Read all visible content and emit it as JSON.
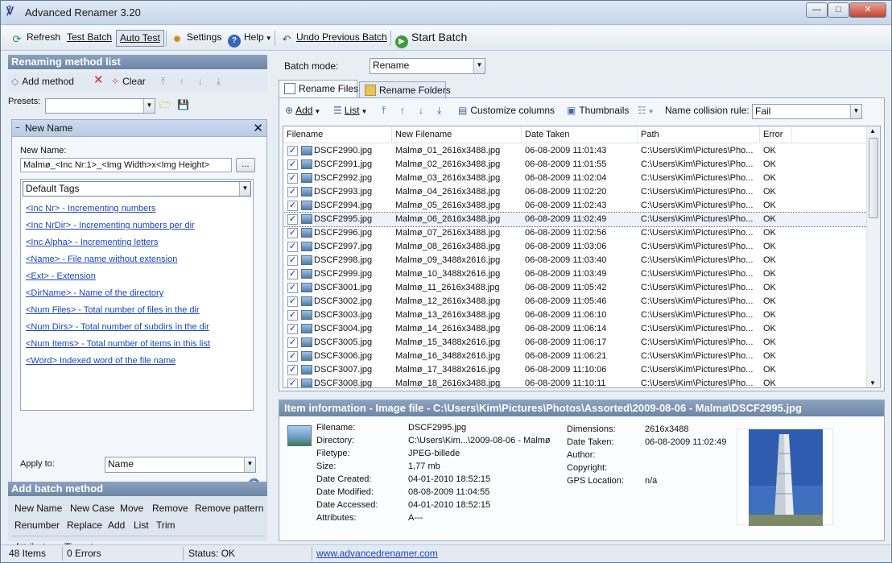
{
  "window": {
    "title": "Advanced Renamer 3.20",
    "controls": {
      "minimize": "—",
      "maximize": "□",
      "close": "✕"
    }
  },
  "toolbar": {
    "refresh": "Refresh",
    "test_batch": "Test Batch",
    "auto_test": "Auto Test",
    "settings": "Settings",
    "help": "Help",
    "undo": "Undo Previous Batch",
    "start": "Start Batch"
  },
  "left": {
    "title": "Renaming method list",
    "add_method": "Add method",
    "clear": "Clear",
    "presets_label": "Presets:",
    "presets_value": "",
    "method": {
      "name": "New Name",
      "new_name_label": "New Name:",
      "new_name_value": "Malmø_<Inc Nr:1>_<Img Width>x<Img Height>",
      "browse": "...",
      "tag_group": "Default Tags",
      "tags": [
        "<Inc Nr> - Incrementing numbers",
        "<Inc NrDir> - Incrementing numbers per dir",
        "<Inc Alpha> - Incrementing letters",
        "<Name> - File name without extension",
        "<Ext> - Extension",
        "<DirName> - Name of the directory",
        "<Num Files> - Total number of files in the dir",
        "<Num Dirs> - Total number of subdirs in the dir",
        "<Num Items> - Total number of items in this list",
        "<Word> Indexed word of the file name"
      ],
      "apply_to_label": "Apply to:",
      "apply_to_value": "Name",
      "help": "?"
    },
    "batch": {
      "title": "Add batch method",
      "methods": [
        "New Name",
        "New Case",
        "Move",
        "Remove",
        "Remove pattern",
        "Renumber",
        "Replace",
        "Add",
        "List",
        "Trim",
        "Attributes",
        "Timestamp"
      ]
    }
  },
  "right": {
    "batch_mode_label": "Batch mode:",
    "batch_mode_value": "Rename",
    "tabs": [
      "Rename Files",
      "Rename Folders"
    ],
    "list_toolbar": {
      "add": "Add",
      "list": "List",
      "customize": "Customize columns",
      "thumbnails": "Thumbnails",
      "collision_label": "Name collision rule:",
      "collision_value": "Fail"
    },
    "columns": [
      "Filename",
      "New Filename",
      "Date Taken",
      "Path",
      "Error"
    ],
    "rows": [
      [
        "DSCF2990.jpg",
        "Malmø_01_2616x3488.jpg",
        "06-08-2009 11:01:43",
        "C:\\Users\\Kim\\Pictures\\Pho...",
        "OK"
      ],
      [
        "DSCF2991.jpg",
        "Malmø_02_2616x3488.jpg",
        "06-08-2009 11:01:55",
        "C:\\Users\\Kim\\Pictures\\Pho...",
        "OK"
      ],
      [
        "DSCF2992.jpg",
        "Malmø_03_2616x3488.jpg",
        "06-08-2009 11:02:04",
        "C:\\Users\\Kim\\Pictures\\Pho...",
        "OK"
      ],
      [
        "DSCF2993.jpg",
        "Malmø_04_2616x3488.jpg",
        "06-08-2009 11:02:20",
        "C:\\Users\\Kim\\Pictures\\Pho...",
        "OK"
      ],
      [
        "DSCF2994.jpg",
        "Malmø_05_2616x3488.jpg",
        "06-08-2009 11:02:43",
        "C:\\Users\\Kim\\Pictures\\Pho...",
        "OK"
      ],
      [
        "DSCF2995.jpg",
        "Malmø_06_2616x3488.jpg",
        "06-08-2009 11:02:49",
        "C:\\Users\\Kim\\Pictures\\Pho...",
        "OK"
      ],
      [
        "DSCF2996.jpg",
        "Malmø_07_2616x3488.jpg",
        "06-08-2009 11:02:56",
        "C:\\Users\\Kim\\Pictures\\Pho...",
        "OK"
      ],
      [
        "DSCF2997.jpg",
        "Malmø_08_2616x3488.jpg",
        "06-08-2009 11:03:06",
        "C:\\Users\\Kim\\Pictures\\Pho...",
        "OK"
      ],
      [
        "DSCF2998.jpg",
        "Malmø_09_3488x2616.jpg",
        "06-08-2009 11:03:40",
        "C:\\Users\\Kim\\Pictures\\Pho...",
        "OK"
      ],
      [
        "DSCF2999.jpg",
        "Malmø_10_3488x2616.jpg",
        "06-08-2009 11:03:49",
        "C:\\Users\\Kim\\Pictures\\Pho...",
        "OK"
      ],
      [
        "DSCF3001.jpg",
        "Malmø_11_2616x3488.jpg",
        "06-08-2009 11:05:42",
        "C:\\Users\\Kim\\Pictures\\Pho...",
        "OK"
      ],
      [
        "DSCF3002.jpg",
        "Malmø_12_2616x3488.jpg",
        "06-08-2009 11:05:46",
        "C:\\Users\\Kim\\Pictures\\Pho...",
        "OK"
      ],
      [
        "DSCF3003.jpg",
        "Malmø_13_2616x3488.jpg",
        "06-08-2009 11:06:10",
        "C:\\Users\\Kim\\Pictures\\Pho...",
        "OK"
      ],
      [
        "DSCF3004.jpg",
        "Malmø_14_2616x3488.jpg",
        "06-08-2009 11:06:14",
        "C:\\Users\\Kim\\Pictures\\Pho...",
        "OK"
      ],
      [
        "DSCF3005.jpg",
        "Malmø_15_3488x2616.jpg",
        "06-08-2009 11:06:17",
        "C:\\Users\\Kim\\Pictures\\Pho...",
        "OK"
      ],
      [
        "DSCF3006.jpg",
        "Malmø_16_3488x2616.jpg",
        "06-08-2009 11:06:21",
        "C:\\Users\\Kim\\Pictures\\Pho...",
        "OK"
      ],
      [
        "DSCF3007.jpg",
        "Malmø_17_3488x2616.jpg",
        "06-08-2009 11:10:06",
        "C:\\Users\\Kim\\Pictures\\Pho...",
        "OK"
      ],
      [
        "DSCF3008.jpg",
        "Malmø_18_2616x3488.jpg",
        "06-08-2009 11:10:11",
        "C:\\Users\\Kim\\Pictures\\Pho...",
        "OK"
      ]
    ],
    "selected_row_index": 5,
    "info": {
      "title": "Item information - Image file - C:\\Users\\Kim\\Pictures\\Photos\\Assorted\\2009-08-06 - Malmø\\DSCF2995.jpg",
      "left": [
        [
          "Filename:",
          "DSCF2995.jpg"
        ],
        [
          "Directory:",
          "C:\\Users\\Kim...\\2009-08-06 - Malmø"
        ],
        [
          "Filetype:",
          "JPEG-billede"
        ],
        [
          "Size:",
          "1,77 mb"
        ],
        [
          "Date Created:",
          "04-01-2010 18:52:15"
        ],
        [
          "Date Modified:",
          "08-08-2009 11:04:55"
        ],
        [
          "Date Accessed:",
          "04-01-2010 18:52:15"
        ],
        [
          "Attributes:",
          "A---"
        ]
      ],
      "right": [
        [
          "Dimensions:",
          "2616x3488"
        ],
        [
          "Date Taken:",
          "06-08-2009 11:02:49"
        ],
        [
          "Author:",
          ""
        ],
        [
          "Copyright:",
          ""
        ],
        [
          "GPS Location:",
          "n/a"
        ]
      ]
    }
  },
  "status": {
    "items": "48 Items",
    "errors": "0 Errors",
    "status": "Status: OK",
    "link": "www.advancedrenamer.com"
  },
  "colors": {
    "header_blue": "#7b93b3",
    "link_blue": "#1a44c8",
    "selected_outline": "#506a8c"
  }
}
